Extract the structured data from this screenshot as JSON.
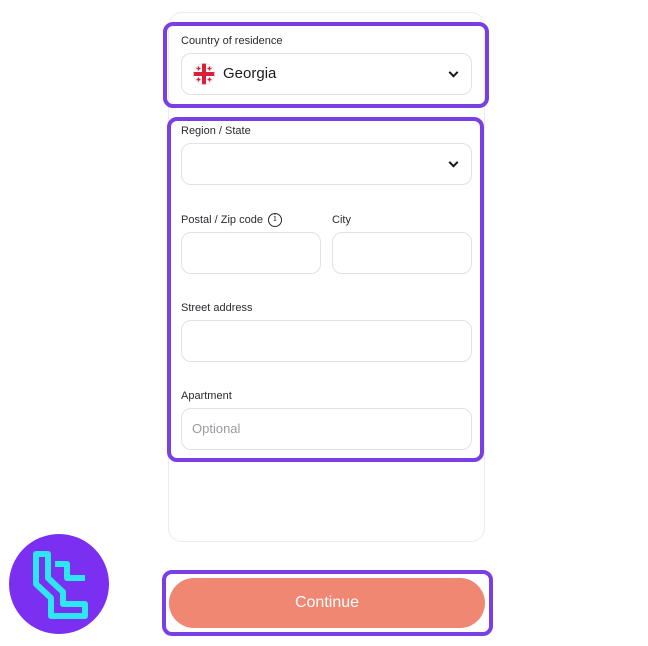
{
  "country": {
    "label": "Country of residence",
    "value": "Georgia",
    "flag_icon": "georgia-flag-icon"
  },
  "region": {
    "label": "Region / State",
    "value": ""
  },
  "postal": {
    "label": "Postal / Zip code",
    "value": ""
  },
  "city": {
    "label": "City",
    "value": ""
  },
  "street": {
    "label": "Street address",
    "value": ""
  },
  "apartment": {
    "label": "Apartment",
    "placeholder": "Optional"
  },
  "continue_label": "Continue",
  "colors": {
    "highlight": "#7a3fe4",
    "continue_button": "#ef8773",
    "logo_background": "#7b2ff0",
    "logo_mark": "#2ee6f0"
  }
}
